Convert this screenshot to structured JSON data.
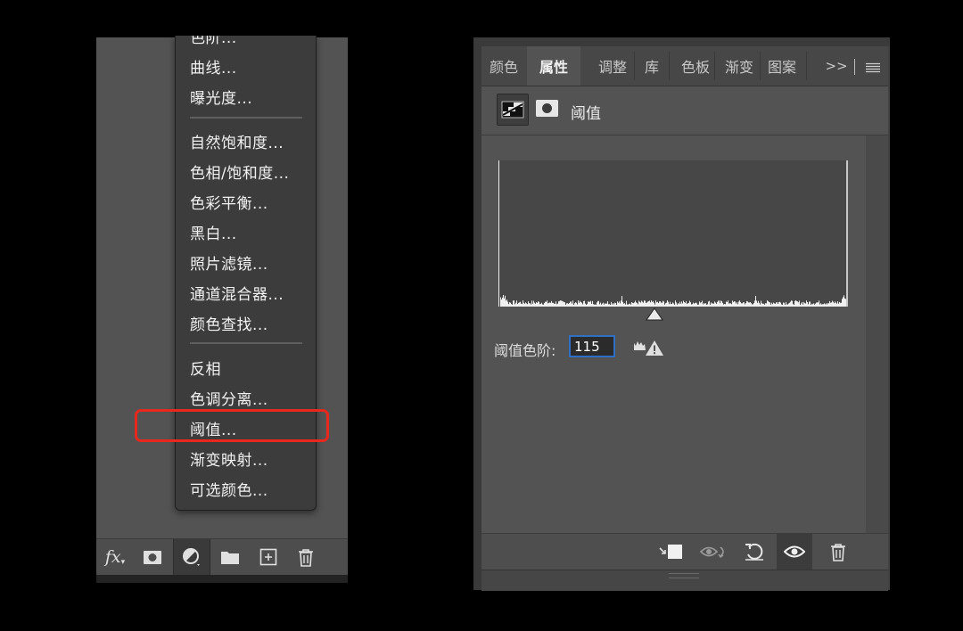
{
  "left_menu": {
    "items": [
      {
        "label": "色阶...",
        "partial": true
      },
      {
        "label": "曲线..."
      },
      {
        "label": "曝光度..."
      },
      {
        "label": "自然饱和度..."
      },
      {
        "label": "色相/饱和度..."
      },
      {
        "label": "色彩平衡..."
      },
      {
        "label": "黑白..."
      },
      {
        "label": "照片滤镜..."
      },
      {
        "label": "通道混合器..."
      },
      {
        "label": "颜色查找..."
      },
      {
        "label": "反相"
      },
      {
        "label": "色调分离..."
      },
      {
        "label": "阈值...",
        "highlighted": true
      },
      {
        "label": "渐变映射..."
      },
      {
        "label": "可选颜色..."
      }
    ],
    "highlight_color": "#e8281c"
  },
  "left_toolbar": {
    "fx_label": "fx",
    "icons": [
      "fx-icon",
      "layer-mask-icon",
      "adjustment-layer-icon",
      "folder-icon",
      "new-layer-icon",
      "trash-icon"
    ]
  },
  "properties_panel": {
    "tabs": [
      {
        "label": "颜色",
        "active": false
      },
      {
        "label": "属性",
        "active": true
      },
      {
        "label": "调整",
        "active": false
      },
      {
        "label": "库",
        "active": false
      },
      {
        "label": "色板",
        "active": false
      },
      {
        "label": "渐变",
        "active": false
      },
      {
        "label": "图案",
        "active": false
      }
    ],
    "overflow_label": ">>",
    "title": "阈值",
    "threshold_label": "阈值色阶:",
    "threshold_value": "115",
    "accent_color": "#2f6fc4"
  }
}
